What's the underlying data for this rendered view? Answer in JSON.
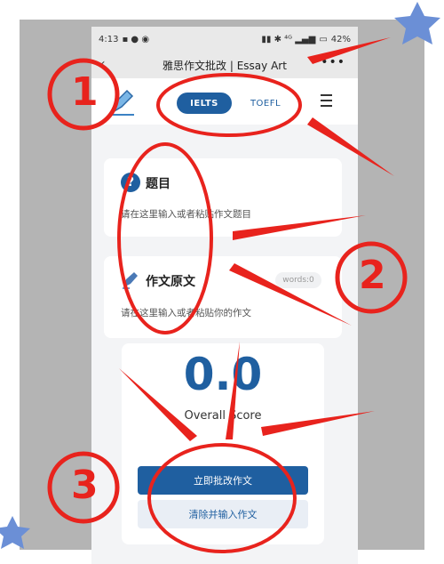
{
  "status_bar": {
    "time": "4:13",
    "battery": "42%"
  },
  "app_bar": {
    "title": "雅思作文批改 | Essay Art"
  },
  "tabs": [
    {
      "label": "IELTS",
      "active": true
    },
    {
      "label": "TOEFL",
      "active": false
    }
  ],
  "topic_section": {
    "title": "题目",
    "placeholder": "请在这里输入或者粘贴作文题目"
  },
  "essay_section": {
    "title": "作文原文",
    "word_count": "words:0",
    "placeholder": "请在这里输入或者粘贴你的作文"
  },
  "score_section": {
    "score": "0.0",
    "label": "Overall Score"
  },
  "actions": {
    "submit_label": "立即批改作文",
    "clear_label": "清除并输入作文"
  },
  "annotations": {
    "step1": "①",
    "step2": "②",
    "step3": "③"
  },
  "colors": {
    "primary": "#1f5fa0",
    "annotation": "#e8231d"
  }
}
